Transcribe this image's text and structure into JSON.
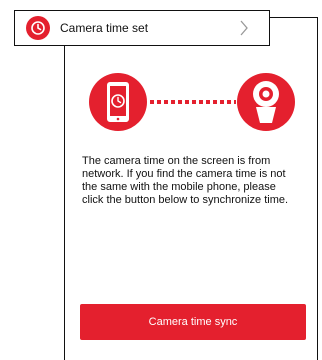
{
  "header": {
    "title": "Camera time set",
    "icon": "clock-icon",
    "chevron_icon": "chevron-right-icon"
  },
  "illustration": {
    "left_icon": "phone-clock-icon",
    "right_icon": "camera-icon",
    "connector": "dotted-link"
  },
  "description": "The camera time on the screen is from\nnetwork. If you find the camera time is not\nthe same with the mobile phone, please\nclick the button below to synchronize time.",
  "sync_button": {
    "label": "Camera time sync"
  },
  "colors": {
    "accent": "#e4202e",
    "text": "#111111",
    "chevron": "#999999"
  }
}
